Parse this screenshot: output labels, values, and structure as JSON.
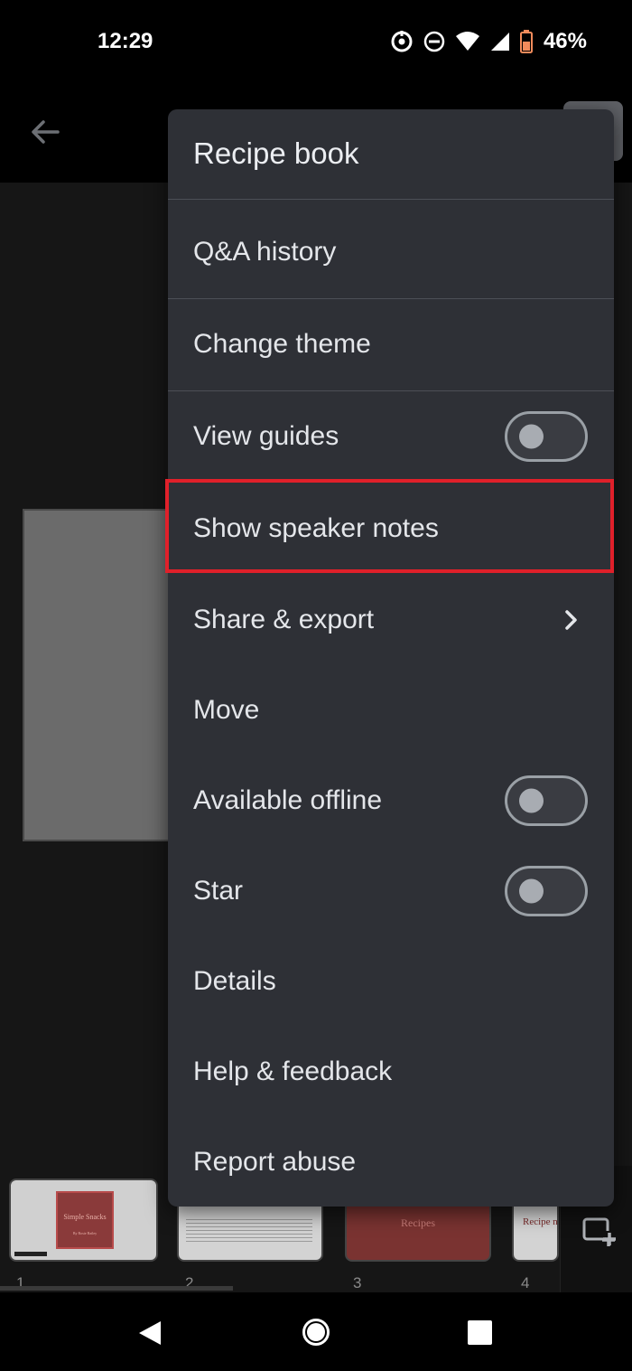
{
  "status_bar": {
    "time": "12:29",
    "battery_percent": "46%",
    "icons": [
      "location-sync-icon",
      "do-not-disturb-icon",
      "wifi-icon",
      "cell-signal-icon",
      "battery-icon"
    ]
  },
  "app_bar": {
    "back_icon": "arrow-left-icon"
  },
  "menu": {
    "title": "Recipe book",
    "items": [
      {
        "label": "Q&A history"
      },
      {
        "label": "Change theme"
      },
      {
        "label": "View guides",
        "toggle": false
      },
      {
        "label": "Show speaker notes"
      },
      {
        "label": "Share & export",
        "icon": "chevron-right-icon"
      },
      {
        "label": "Move"
      },
      {
        "label": "Available offline",
        "toggle": false
      },
      {
        "label": "Star",
        "toggle": false
      },
      {
        "label": "Details"
      },
      {
        "label": "Help & feedback"
      },
      {
        "label": "Report abuse"
      }
    ],
    "highlight_color": "#e0202a"
  },
  "filmstrip": {
    "slides": [
      {
        "number": "1",
        "title": "Simple Snacks",
        "subtitle": "By Rosie Bailey"
      },
      {
        "number": "2"
      },
      {
        "number": "3",
        "title": "Recipes"
      },
      {
        "number": "4",
        "title": "Recipe na"
      }
    ],
    "add_slide_icon": "add-slide-icon"
  },
  "nav_bar": {
    "icons": [
      "nav-back-icon",
      "nav-home-icon",
      "nav-recents-icon"
    ]
  }
}
